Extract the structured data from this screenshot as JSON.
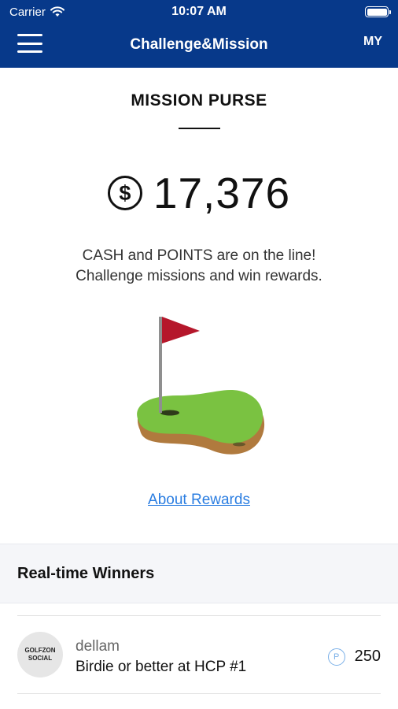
{
  "status_bar": {
    "carrier": "Carrier",
    "time": "10:07 AM",
    "wifi_icon": "wifi-icon",
    "battery_icon": "battery-icon"
  },
  "nav": {
    "title": "Challenge&Mission",
    "my_label": "MY",
    "menu_icon": "hamburger-menu-icon",
    "background_color": "#07398a"
  },
  "purse": {
    "title": "MISSION PURSE",
    "currency_icon": "dollar-circle-icon",
    "currency_symbol": "$",
    "amount": "17,376",
    "description_line1": "CASH and POINTS are on the line!",
    "description_line2": "Challenge missions and win rewards."
  },
  "illustration": {
    "name": "golf-flag-green-illustration",
    "colors": {
      "flag": "#b5172b",
      "green": "#7ac241",
      "base": "#b07a3e"
    }
  },
  "about_rewards_label": "About Rewards",
  "winners": {
    "title": "Real-time Winners",
    "items": [
      {
        "avatar_line1": "GOLFZON",
        "avatar_line2": "SOCIAL",
        "name": "dellam",
        "mission": "Birdie or better at HCP #1",
        "points_icon_letter": "P",
        "points": "250"
      }
    ]
  },
  "link_color": "#2a7de1"
}
